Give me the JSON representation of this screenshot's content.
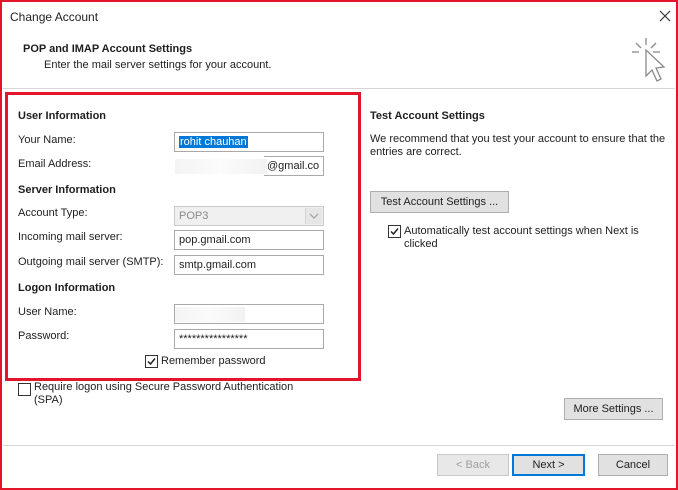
{
  "window": {
    "title": "Change Account"
  },
  "header": {
    "title": "POP and IMAP Account Settings",
    "subtitle": "Enter the mail server settings for your account."
  },
  "user_information": {
    "heading": "User Information",
    "your_name_label": "Your Name:",
    "your_name_value": "rohit chauhan",
    "email_label": "Email Address:",
    "email_value_visible": "@gmail.co"
  },
  "server_information": {
    "heading": "Server Information",
    "account_type_label": "Account Type:",
    "account_type_value": "POP3",
    "incoming_label": "Incoming mail server:",
    "incoming_value": "pop.gmail.com",
    "outgoing_label": "Outgoing mail server (SMTP):",
    "outgoing_value": "smtp.gmail.com"
  },
  "logon_information": {
    "heading": "Logon Information",
    "username_label": "User Name:",
    "password_label": "Password:",
    "password_value": "****************",
    "remember_label": "Remember password",
    "remember_checked": true
  },
  "spa": {
    "label": "Require logon using Secure Password Authentication (SPA)",
    "checked": false
  },
  "test_settings": {
    "heading": "Test Account Settings",
    "description": "We recommend that you test your account to ensure that the entries are correct.",
    "button_label": "Test Account Settings ...",
    "auto_test_label": "Automatically test account settings when Next is clicked",
    "auto_test_checked": true
  },
  "buttons": {
    "more_settings": "More Settings ...",
    "back": "< Back",
    "next": "Next >",
    "cancel": "Cancel"
  },
  "colors": {
    "highlight_frame": "#e2152b",
    "selection": "#0078d7"
  },
  "icons": {
    "close": "close-icon",
    "wizard": "cursor-click-icon",
    "check": "checkmark-icon"
  }
}
